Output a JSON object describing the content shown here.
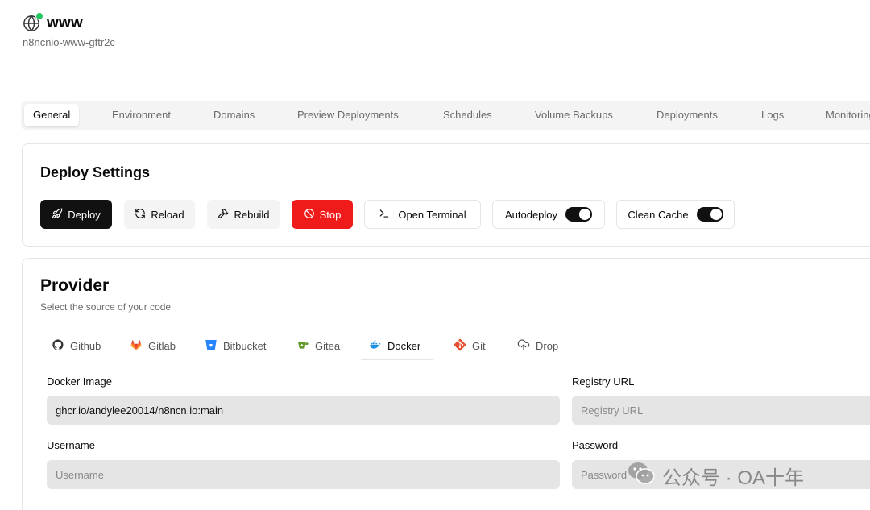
{
  "app": {
    "title": "www",
    "subtitle": "n8ncnio-www-gftr2c",
    "status_color": "#22c55e"
  },
  "tabs": [
    {
      "label": "General",
      "active": true
    },
    {
      "label": "Environment"
    },
    {
      "label": "Domains"
    },
    {
      "label": "Preview Deployments"
    },
    {
      "label": "Schedules"
    },
    {
      "label": "Volume Backups"
    },
    {
      "label": "Deployments"
    },
    {
      "label": "Logs"
    },
    {
      "label": "Monitoring"
    }
  ],
  "deploy_settings": {
    "title": "Deploy Settings",
    "buttons": {
      "deploy": "Deploy",
      "reload": "Reload",
      "rebuild": "Rebuild",
      "stop": "Stop",
      "open_terminal": "Open Terminal",
      "autodeploy": "Autodeploy",
      "clean_cache": "Clean Cache"
    },
    "autodeploy_on": true,
    "clean_cache_on": true
  },
  "provider": {
    "title": "Provider",
    "subtitle": "Select the source of your code",
    "tabs": [
      {
        "label": "Github",
        "icon": "github-icon"
      },
      {
        "label": "Gitlab",
        "icon": "gitlab-icon"
      },
      {
        "label": "Bitbucket",
        "icon": "bitbucket-icon"
      },
      {
        "label": "Gitea",
        "icon": "gitea-icon"
      },
      {
        "label": "Docker",
        "icon": "docker-icon",
        "active": true
      },
      {
        "label": "Git",
        "icon": "git-icon"
      },
      {
        "label": "Drop",
        "icon": "cloud-upload-icon"
      }
    ],
    "fields": {
      "docker_image": {
        "label": "Docker Image",
        "value": "ghcr.io/andylee20014/n8ncn.io:main"
      },
      "registry_url": {
        "label": "Registry URL",
        "placeholder": "Registry URL"
      },
      "username": {
        "label": "Username",
        "placeholder": "Username"
      },
      "password": {
        "label": "Password",
        "placeholder": "Password"
      }
    }
  },
  "watermark": {
    "text": "公众号 · OA十年"
  },
  "colors": {
    "accent_dark": "#111111",
    "stop_red": "#ef1b1b",
    "field_bg": "#e5e5e5"
  }
}
